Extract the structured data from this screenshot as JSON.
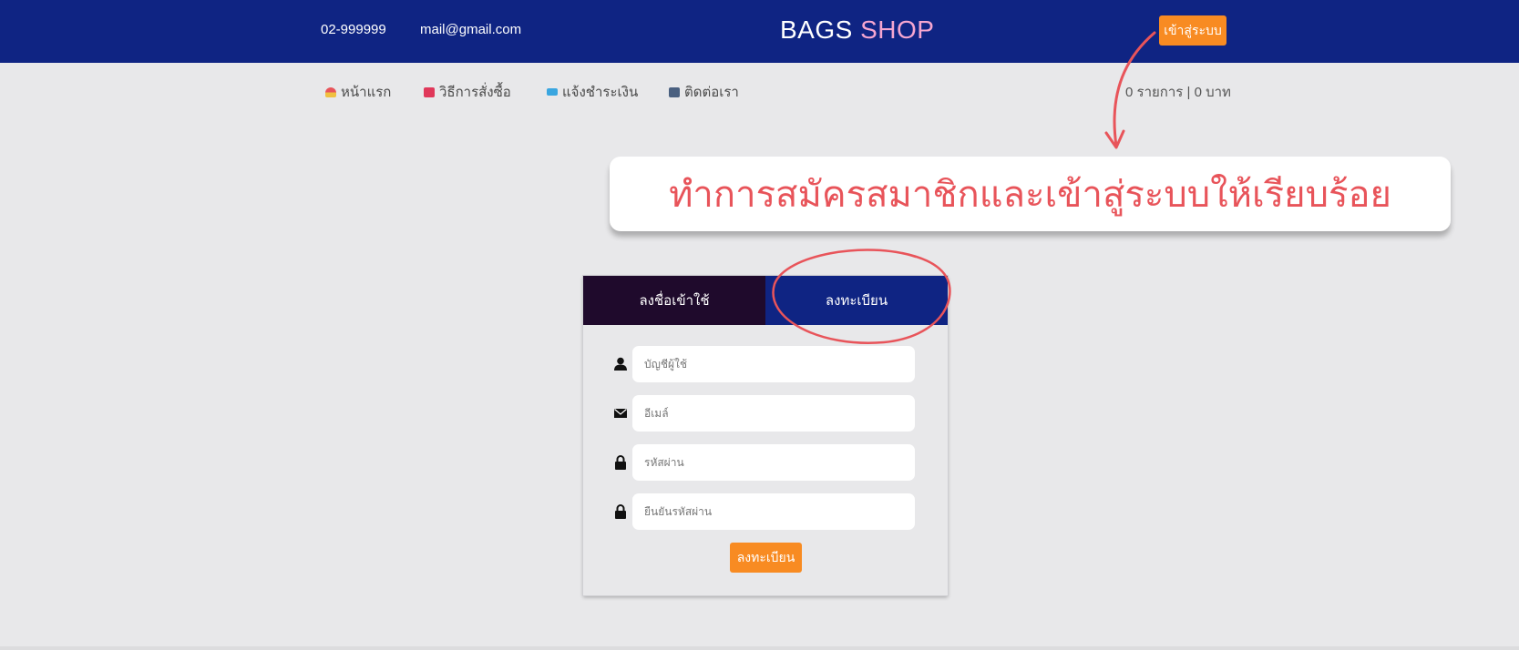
{
  "header": {
    "phone": "02-999999",
    "email": "mail@gmail.com",
    "brand_part1": "BAGS",
    "brand_part2": "SHOP",
    "login_label": "เข้าสู่ระบบ"
  },
  "nav": {
    "items": [
      {
        "label": "หน้าแรก",
        "icon": "home-icon"
      },
      {
        "label": "วิธีการสั่งซื้อ",
        "icon": "order-icon"
      },
      {
        "label": "แจ้งชำระเงิน",
        "icon": "payment-icon"
      },
      {
        "label": "ติดต่อเรา",
        "icon": "phone-icon"
      }
    ],
    "cart_summary": "0 รายการ | 0 บาท"
  },
  "annotation": {
    "text": "ทำการสมัครสมาชิกและเข้าสู่ระบบให้เรียบร้อย",
    "color": "#e8545a"
  },
  "form": {
    "tabs": [
      {
        "label": "ลงชื่อเข้าใช้",
        "active": false
      },
      {
        "label": "ลงทะเบียน",
        "active": true
      }
    ],
    "fields": [
      {
        "placeholder": "บัญชีผู้ใช้",
        "icon": "user-icon"
      },
      {
        "placeholder": "อีเมล์",
        "icon": "envelope-icon"
      },
      {
        "placeholder": "รหัสผ่าน",
        "icon": "lock-icon"
      },
      {
        "placeholder": "ยืนยันรหัสผ่าน",
        "icon": "lock-icon"
      }
    ],
    "submit_label": "ลงทะเบียน"
  },
  "colors": {
    "header_bg": "#0f2483",
    "accent": "#f88b22",
    "brand_pink": "#f5a6d0",
    "login_tab_bg": "#1f0a2c",
    "page_bg": "#e8e8ea"
  }
}
